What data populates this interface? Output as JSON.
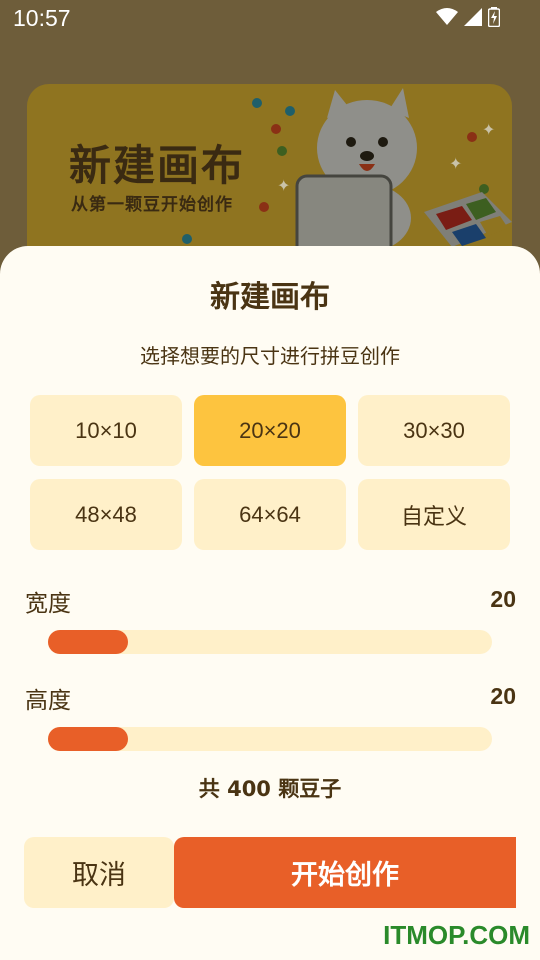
{
  "status_bar": {
    "time": "10:57",
    "icons": [
      "wifi-icon",
      "signal-icon",
      "battery-charging-icon"
    ]
  },
  "banner": {
    "title": "新建画布",
    "subtitle": "从第一颗豆开始创作"
  },
  "dialog": {
    "title": "新建画布",
    "subtitle": "选择想要的尺寸进行拼豆创作",
    "size_options": [
      {
        "label": "10×10",
        "selected": false
      },
      {
        "label": "20×20",
        "selected": true
      },
      {
        "label": "30×30",
        "selected": false
      },
      {
        "label": "48×48",
        "selected": false
      },
      {
        "label": "64×64",
        "selected": false
      },
      {
        "label": "自定义",
        "selected": false
      }
    ],
    "width": {
      "label": "宽度",
      "value": "20",
      "fill_fraction": 0.18
    },
    "height": {
      "label": "高度",
      "value": "20",
      "fill_fraction": 0.18
    },
    "total": "共 400 颗豆子",
    "cancel_label": "取消",
    "start_label": "开始创作"
  },
  "watermark": "ITMOP.COM",
  "colors": {
    "accent": "#e85f28",
    "selected": "#fdc43f",
    "option_bg": "#fff0c9",
    "sheet_bg": "#fffcf3",
    "text": "#4a3413"
  }
}
